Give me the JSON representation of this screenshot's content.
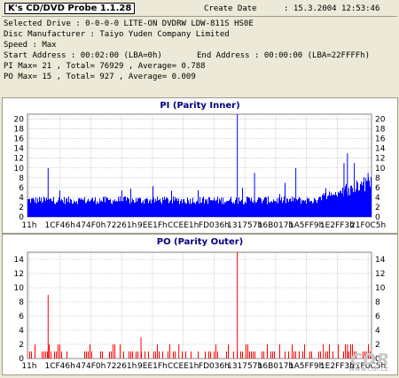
{
  "header": {
    "app_title": "K's CD/DVD Probe 1.1.28",
    "create_date_label": "Create Date",
    "create_date_value": ":   15.3.2004  12:53:46",
    "selected_drive": "Selected Drive : 0-0-0-0  LITE-ON DVDRW LDW-811S   HS0E",
    "disc_manufacturer": "Disc Manufacturer : Taiyo Yuden Company Limited",
    "speed": "Speed                : Max",
    "start_address": "Start Address    : 00:02:00 (LBA=0h)",
    "end_address": "End Address       : 00:00:00 (LBA=22FFFFh)",
    "pi_stats": "PI Max= 21 , Total= 76929 , Average= 0.788",
    "po_stats": "PO Max= 15 , Total= 927  , Average= 0.009"
  },
  "chart_data": [
    {
      "type": "bar",
      "title": "PI (Parity Inner)",
      "color": "#0000ff",
      "ylim": [
        0,
        21
      ],
      "yticks": [
        0,
        2,
        4,
        6,
        8,
        10,
        12,
        14,
        16,
        18,
        20
      ],
      "xticks": [
        "11h",
        "1CF46h",
        "474F0h",
        "72261h",
        "9EE1Fh",
        "CCEE1h",
        "FD036h",
        "131757h",
        "16B017h",
        "1A5FF9h",
        "1E2FF3h",
        "21F0C5h"
      ],
      "grid": true,
      "baseline": 3,
      "peaks": [
        {
          "pos": 0.06,
          "value": 10
        },
        {
          "pos": 0.61,
          "value": 21
        },
        {
          "pos": 0.66,
          "value": 9
        },
        {
          "pos": 0.78,
          "value": 10
        },
        {
          "pos": 0.93,
          "value": 13
        },
        {
          "pos": 0.92,
          "value": 11
        },
        {
          "pos": 0.95,
          "value": 11
        },
        {
          "pos": 0.99,
          "value": 9
        }
      ]
    },
    {
      "type": "bar",
      "title": "PO (Parity Outer)",
      "color": "#ff0000",
      "ylim": [
        0,
        15
      ],
      "yticks": [
        0,
        2,
        4,
        6,
        8,
        10,
        12,
        14
      ],
      "xticks": [
        "11h",
        "1CF46h",
        "474F0h",
        "72261h",
        "9EE1Fh",
        "CCEE1h",
        "FD036h",
        "131757h",
        "16B017h",
        "1A5FF9h",
        "1E2FF3h",
        "21F0C5h"
      ],
      "grid": true,
      "peaks": [
        {
          "pos": 0.06,
          "value": 9
        },
        {
          "pos": 0.61,
          "value": 15
        },
        {
          "pos": 0.33,
          "value": 3
        },
        {
          "pos": 0.44,
          "value": 2
        },
        {
          "pos": 0.86,
          "value": 2
        },
        {
          "pos": 0.93,
          "value": 2
        }
      ]
    }
  ],
  "watermark": "CDR",
  "watermark_url": "www.cdr.cz"
}
